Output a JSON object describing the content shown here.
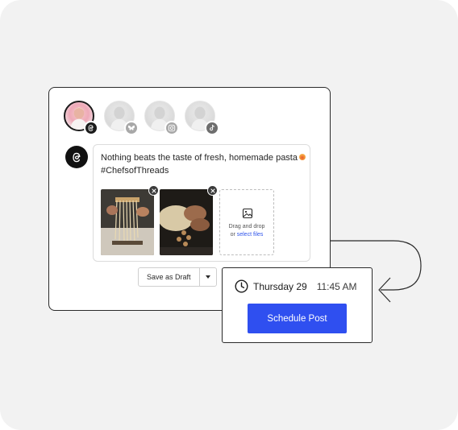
{
  "colors": {
    "accent": "#2f4ff0",
    "link": "#2f54eb",
    "background": "#f2f2f2"
  },
  "accounts": [
    {
      "network": "threads",
      "badge_icon": "threads-icon",
      "selected": true
    },
    {
      "network": "bluesky",
      "badge_icon": "butterfly-icon",
      "selected": false
    },
    {
      "network": "instagram",
      "badge_icon": "instagram-icon",
      "selected": false
    },
    {
      "network": "tiktok",
      "badge_icon": "tiktok-icon",
      "selected": false
    }
  ],
  "post": {
    "text_line1": "Nothing beats the taste of fresh, homemade pasta",
    "text_line2": "#ChefsofThreads",
    "emoji_icon": "pasta-emoji-icon"
  },
  "media": {
    "images": [
      {
        "name": "pasta-hanging-photo"
      },
      {
        "name": "pasta-shaping-photo"
      }
    ],
    "dropzone_line1": "Drag and drop",
    "dropzone_line2_prefix": "or ",
    "dropzone_link": "select files",
    "dropzone_icon": "image-icon"
  },
  "draft": {
    "label": "Save as Draft",
    "caret_icon": "chevron-down-icon"
  },
  "schedule": {
    "day": "Thursday 29",
    "time": "11:45 AM",
    "button_label": "Schedule Post",
    "clock_icon": "clock-icon"
  }
}
